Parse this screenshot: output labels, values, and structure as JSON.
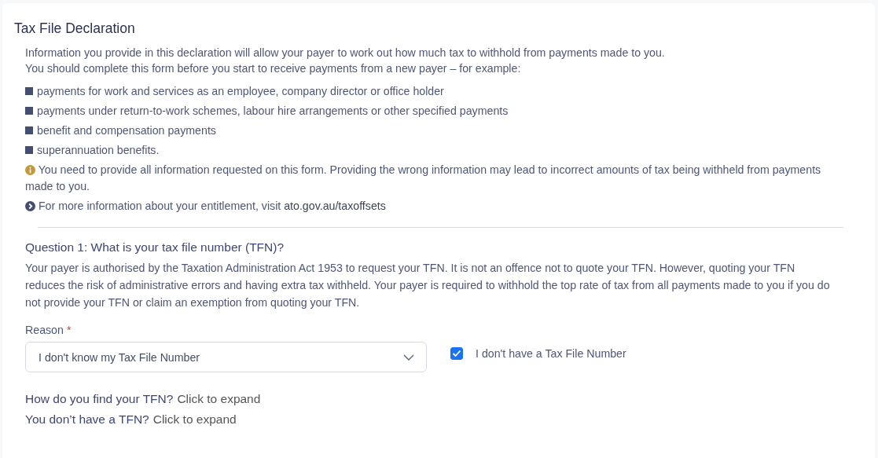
{
  "title": "Tax File Declaration",
  "intro": [
    "Information you provide in this declaration will allow your payer to work out how much tax to withhold from payments made to you.",
    "You should complete this form before you start to receive payments from a new payer – for example:"
  ],
  "bullets": [
    "payments for work and services as an employee, company director or office holder",
    "payments under return-to-work schemes, labour hire arrangements or other specified payments",
    "benefit and compensation payments",
    "superannuation benefits."
  ],
  "notes": [
    {
      "kind": "info",
      "text": "You need to provide all information requested on this form. Providing the wrong information may lead to incorrect amounts of tax being withheld from payments made to you."
    },
    {
      "kind": "more",
      "text": "For more information about your entitlement, visit ",
      "link": "ato.gov.au/taxoffsets"
    }
  ],
  "question": {
    "title": "Question 1: What is your tax file number (TFN)?",
    "text": "Your payer is authorised by the Taxation Administration Act 1953 to request your TFN. It is not an offence not to quote your TFN. However, quoting your TFN reduces the risk of administrative errors and having extra tax withheld. Your payer is required to withhold the top rate of tax from all payments made to you if you do not provide your TFN or claim an exemption from quoting your TFN."
  },
  "reason": {
    "label": "Reason",
    "required_mark": "*",
    "value": "I don't know my Tax File Number"
  },
  "no_tfn": {
    "label": "I don't have a Tax File Number",
    "checked": true
  },
  "expanders": [
    {
      "question": "How do you find your TFN?",
      "action": "Click to expand"
    },
    {
      "question": "You don’t have a TFN?",
      "action": "Click to expand"
    }
  ]
}
